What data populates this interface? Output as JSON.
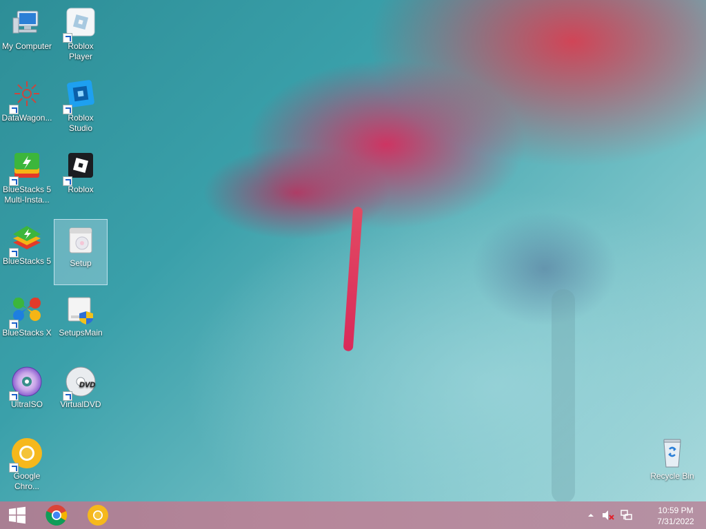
{
  "desktop": {
    "icons": [
      {
        "label": "My Computer",
        "icon": "computer-icon"
      },
      {
        "label": "Roblox Player",
        "icon": "roblox-player-icon"
      },
      {
        "label": "DataWagon...",
        "icon": "datawagon-icon"
      },
      {
        "label": "Roblox Studio",
        "icon": "roblox-studio-icon"
      },
      {
        "label": "BlueStacks 5 Multi-Insta...",
        "icon": "bluestacks-multi-icon"
      },
      {
        "label": "Roblox",
        "icon": "roblox-icon"
      },
      {
        "label": "BlueStacks 5",
        "icon": "bluestacks-icon"
      },
      {
        "label": "Setup",
        "icon": "setup-icon"
      },
      {
        "label": "BlueStacks X",
        "icon": "bluestacks-x-icon"
      },
      {
        "label": "SetupsMain",
        "icon": "setupsmain-icon"
      },
      {
        "label": "UltraISO",
        "icon": "ultraiso-icon"
      },
      {
        "label": "VirtualDVD",
        "icon": "virtualdvd-icon"
      },
      {
        "label": "Google Chro...",
        "icon": "google-chrome-canary-icon"
      },
      {
        "label": "Recycle Bin",
        "icon": "recycle-bin-icon"
      }
    ],
    "selected_icon": "Setup"
  },
  "taskbar": {
    "start_icon": "windows-start-icon",
    "pinned": [
      {
        "name": "chrome-icon"
      },
      {
        "name": "chrome-canary-icon"
      }
    ],
    "tray": {
      "show_hidden_icon": "chevron-up-icon",
      "volume_icon": "speaker-muted-icon",
      "network_icon": "network-icon",
      "time": "10:59 PM",
      "date": "7/31/2022"
    }
  },
  "colors": {
    "taskbar": "#b6869a",
    "wallpaper_teal": "#3aa0aa",
    "flower_pink": "#e02a60"
  }
}
